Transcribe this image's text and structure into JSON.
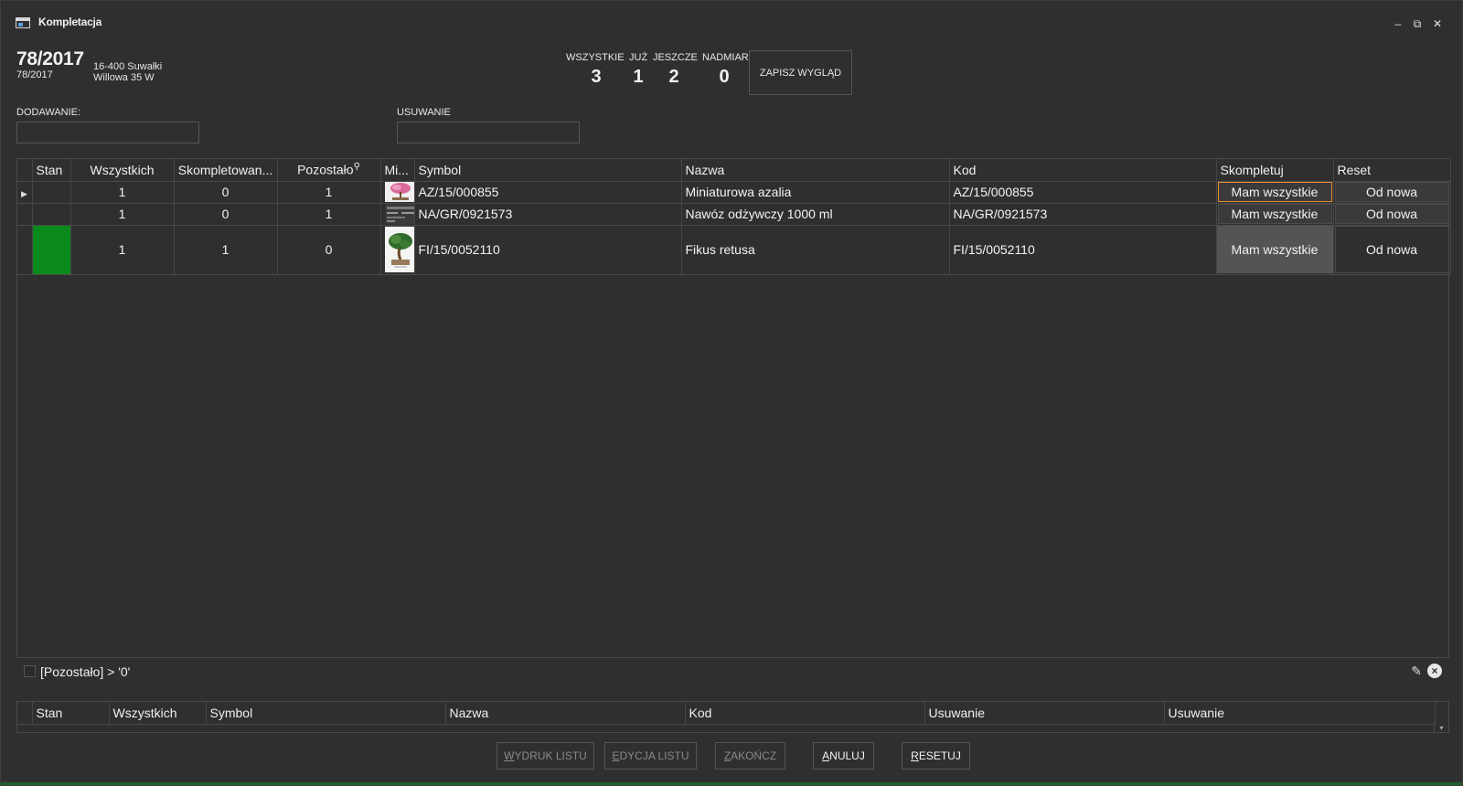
{
  "window": {
    "title": "Kompletacja"
  },
  "document": {
    "number": "78/2017",
    "sub_number": "78/2017",
    "address_line1": "16-400 Suwałki",
    "address_line2": "Willowa 35 W"
  },
  "counters": [
    {
      "label": "WSZYSTKIE",
      "value": "3"
    },
    {
      "label": "JUŻ",
      "value": "1"
    },
    {
      "label": "JESZCZE",
      "value": "2"
    },
    {
      "label": "NADMIAR",
      "value": "0"
    }
  ],
  "save_layout_label": "ZAPISZ WYGLĄD",
  "fields": {
    "adding_label": "DODAWANIE:",
    "adding_value": "",
    "removing_label": "USUWANIE",
    "removing_value": ""
  },
  "grid": {
    "columns": [
      "Stan",
      "Wszystkich",
      "Skompletowan...",
      "Pozostało",
      "Mi...",
      "Symbol",
      "Nazwa",
      "Kod",
      "Skompletuj",
      "Reset"
    ],
    "filter_glyph": "⚲",
    "rows": [
      {
        "stan": "",
        "wszystkich": "1",
        "skompletowane": "0",
        "pozostalo": "1",
        "symbol": "AZ/15/000855",
        "nazwa": "Miniaturowa azalia",
        "kod": "AZ/15/000855",
        "skompletuj": "Mam wszystkie",
        "reset": "Od nowa"
      },
      {
        "stan": "",
        "wszystkich": "1",
        "skompletowane": "0",
        "pozostalo": "1",
        "symbol": "NA/GR/0921573",
        "nazwa": "Nawóz odżywczy 1000 ml",
        "kod": "NA/GR/0921573",
        "skompletuj": "Mam wszystkie",
        "reset": "Od nowa"
      },
      {
        "stan": "",
        "wszystkich": "1",
        "skompletowane": "1",
        "pozostalo": "0",
        "symbol": "FI/15/0052110",
        "nazwa": "Fikus retusa",
        "kod": "FI/15/0052110",
        "skompletuj": "Mam wszystkie",
        "reset": "Od nowa"
      }
    ],
    "stan_colors": [
      "",
      "",
      "#0a8a1c"
    ]
  },
  "filter": {
    "text": "[Pozostało] > '0'",
    "edit_icon": "pencil-icon",
    "clear_icon": "close-circle-icon"
  },
  "grid2": {
    "columns": [
      "Stan",
      "Wszystkich",
      "Symbol",
      "Nazwa",
      "Kod",
      "Usuwanie",
      "Usuwanie"
    ]
  },
  "buttons": {
    "print": "WYDRUK LISTU",
    "edit": "EDYCJA LISTU",
    "finish": "ZAKOŃCZ",
    "cancel": "ANULUJ",
    "reset": "RESETUJ"
  }
}
